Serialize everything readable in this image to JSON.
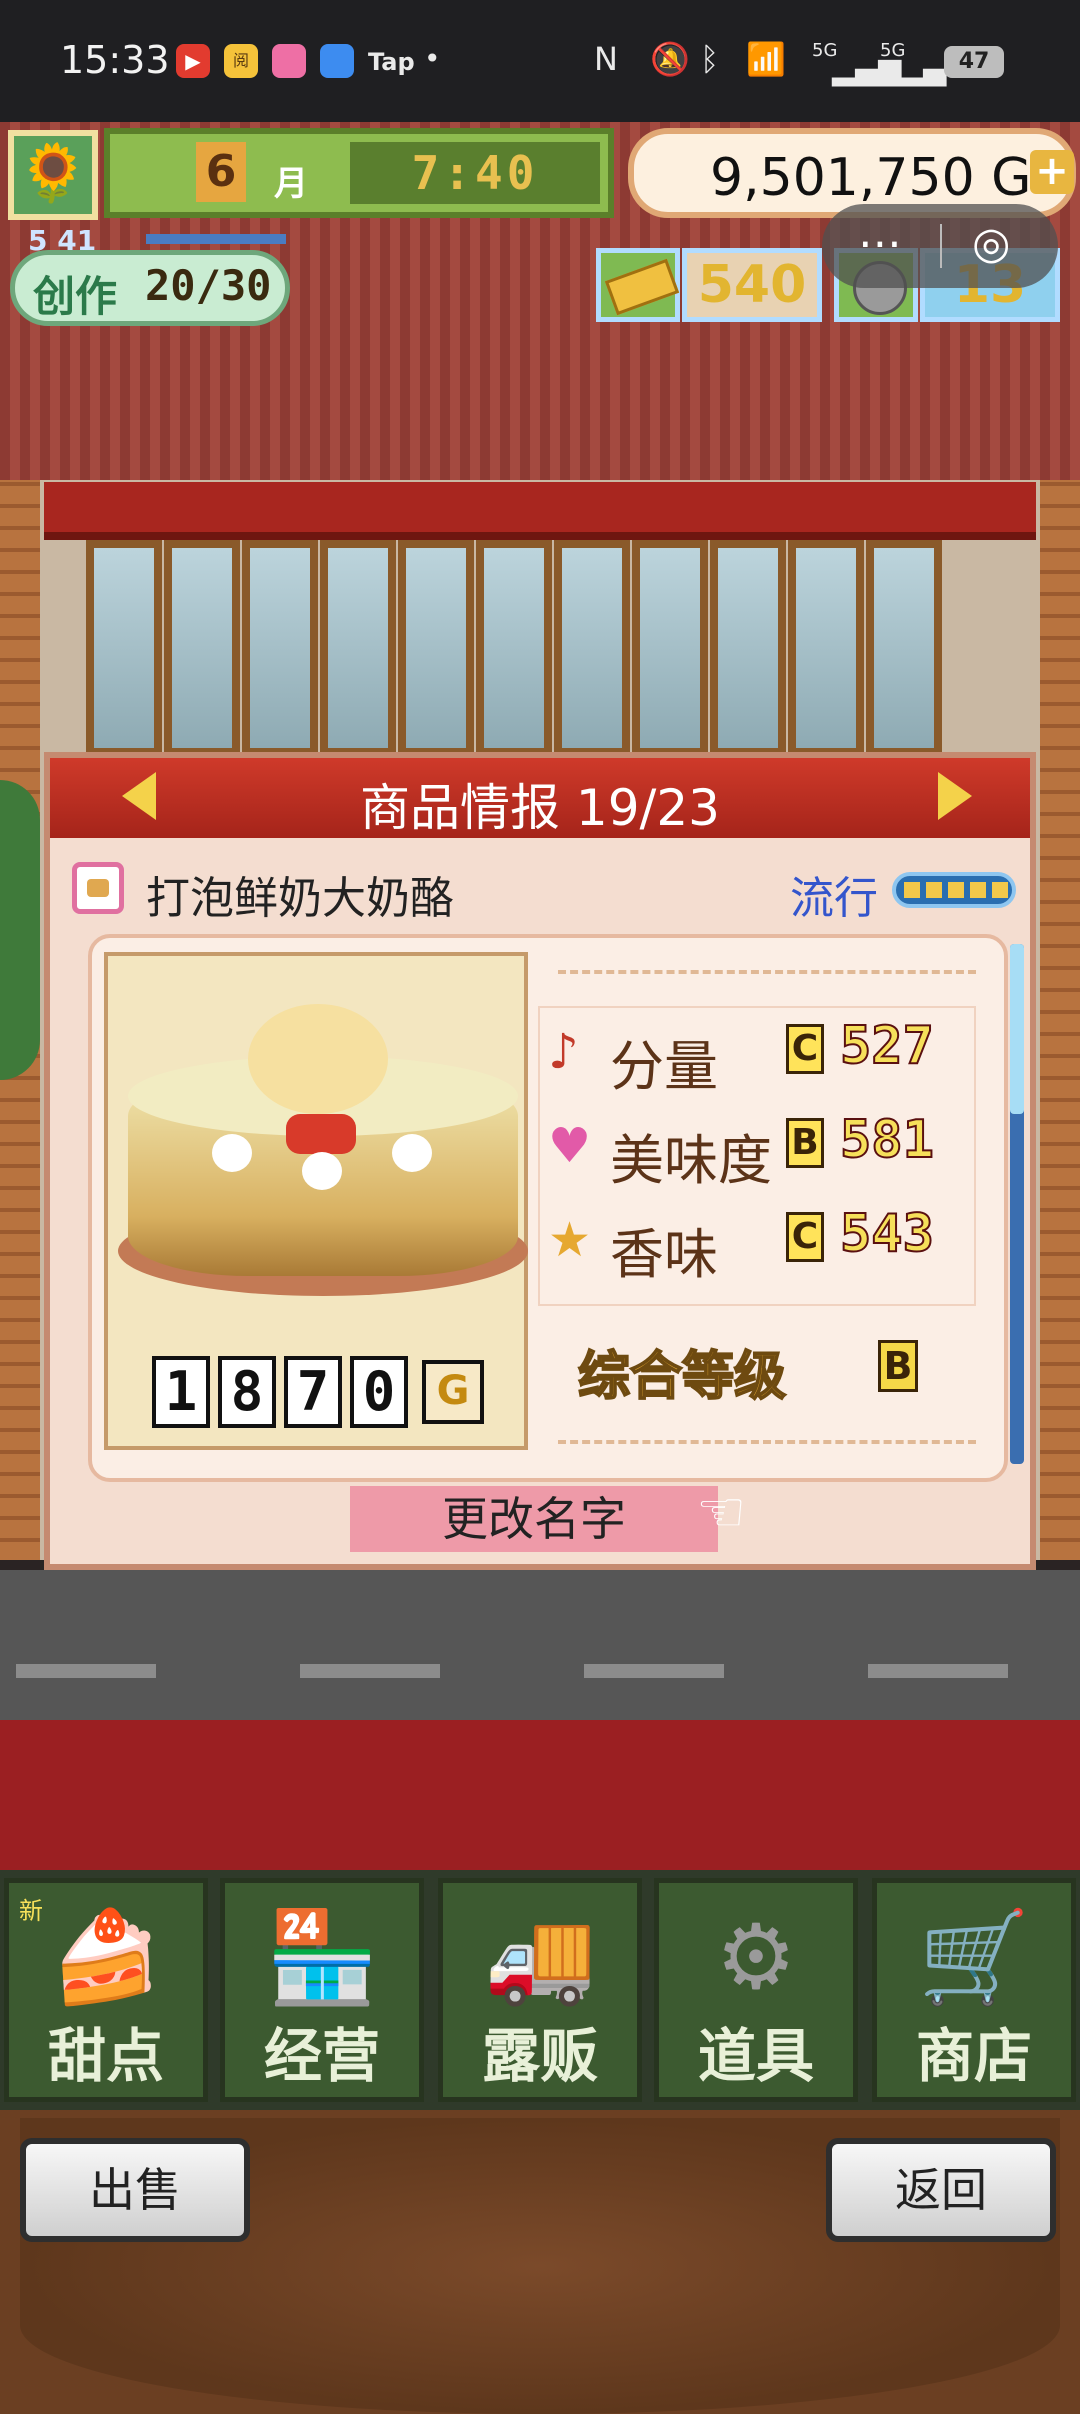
{
  "status_bar": {
    "time": "15:33",
    "app_icons": [
      {
        "name": "video-app-icon",
        "color": "#e23b2f",
        "label": "▶"
      },
      {
        "name": "reading-app-icon",
        "color": "#f5c23a",
        "label": "阅"
      },
      {
        "name": "shopping-app-icon",
        "color": "#ee6fa5",
        "label": ""
      },
      {
        "name": "chat-app-icon",
        "color": "#3d8cf0",
        "label": ""
      }
    ],
    "tap_label": "Tap",
    "dot": "•",
    "signal_labels": [
      "5G",
      "5G"
    ],
    "battery": "47"
  },
  "hud": {
    "month": "6",
    "month_unit": "月",
    "clock": "7:40",
    "gold": "9,501,750 G",
    "gold_plus": "+",
    "rank": "5 41",
    "create_label": "创作",
    "create_count": "20/30",
    "ticket_count": "540",
    "medal_count": "13",
    "icons": {
      "sun": "sunflower-icon",
      "ticket": "gold-ticket-icon",
      "medal": "medal-icon"
    }
  },
  "dialog": {
    "title": "商品情报 19/23",
    "product_name": "打泡鲜奶大奶酪",
    "trend_label": "流行",
    "trend_level": 5,
    "price_digits": [
      "1",
      "8",
      "7",
      "0"
    ],
    "price_unit": "G",
    "stats": [
      {
        "name": "分量",
        "grade": "C",
        "value": "527",
        "icon": "music-note-icon",
        "icon_char": "♪",
        "icon_color": "#c23a2a"
      },
      {
        "name": "美味度",
        "grade": "B",
        "value": "581",
        "icon": "heart-icon",
        "icon_char": "♥",
        "icon_color": "#e25aa8"
      },
      {
        "name": "香味",
        "grade": "C",
        "value": "543",
        "icon": "star-icon",
        "icon_char": "★",
        "icon_color": "#e6a830"
      }
    ],
    "overall_label": "综合等级",
    "overall_grade": "B",
    "rename_label": "更改名字"
  },
  "nav": {
    "new_badge": "新",
    "items": [
      {
        "label": "甜点",
        "icon": "cake-icon",
        "icon_char": "🍰"
      },
      {
        "label": "经营",
        "icon": "shop-building-icon",
        "icon_char": "🏪"
      },
      {
        "label": "露贩",
        "icon": "food-truck-icon",
        "icon_char": "🚚"
      },
      {
        "label": "道具",
        "icon": "gear-bag-icon",
        "icon_char": "⚙"
      },
      {
        "label": "商店",
        "icon": "cart-icon",
        "icon_char": "🛒"
      }
    ]
  },
  "footer": {
    "sell_label": "出售",
    "back_label": "返回"
  },
  "colors": {
    "title_bar": "#b82d20",
    "accent_gold": "#e8b640",
    "trend_blue": "#3355cc",
    "rename_pink": "#ee9aa8"
  }
}
